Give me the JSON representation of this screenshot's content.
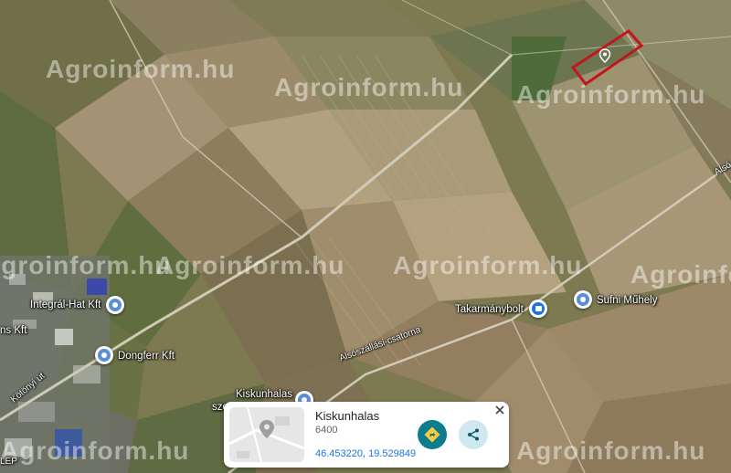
{
  "map": {
    "view": "satellite",
    "field_outline_color": "#c0161c",
    "pin_color": "#5a8fd6",
    "shop_pin_color": "#1a73e8"
  },
  "watermark": {
    "text": "Agroinform.hu"
  },
  "road_labels": {
    "canal": "Alsószállási-csatorna",
    "road_right": "Alsó",
    "kotonyi": "Kötönyi út",
    "lep": "LEP",
    "szenny": "szenny",
    "ns": "ns Kft"
  },
  "places": [
    {
      "name": "Integrál-Hat Kft",
      "icon": "place-pin-icon"
    },
    {
      "name": "Dongferr Kft",
      "icon": "place-pin-icon"
    },
    {
      "name": "Takarmánybolt",
      "icon": "shopping-bag-icon"
    },
    {
      "name": "Sufni Műhely",
      "icon": "place-pin-icon"
    },
    {
      "name": "Kiskunhalas",
      "icon": "place-pin-icon"
    }
  ],
  "card": {
    "title": "Kiskunhalas",
    "postal_code": "6400",
    "coordinates": "46.453220, 19.529849",
    "directions_icon": "directions-icon",
    "share_icon": "share-icon",
    "close_icon": "close-icon",
    "thumbnail_icon": "map-thumbnail-icon"
  }
}
